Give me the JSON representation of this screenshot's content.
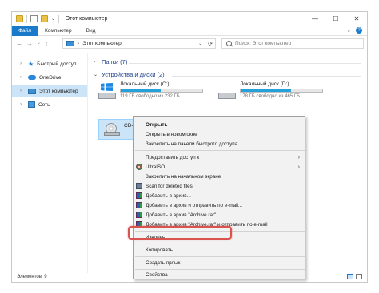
{
  "window": {
    "title": "Этот компьютер",
    "controls": {
      "minimize": "—",
      "maximize": "☐",
      "close": "✕"
    }
  },
  "ribbon": {
    "tabs": [
      {
        "label": "Файл",
        "active": true
      },
      {
        "label": "Компьютер"
      },
      {
        "label": "Вид"
      }
    ],
    "expand": "⌄",
    "help": "?"
  },
  "address": {
    "path": "Этот компьютер",
    "chevron": "›",
    "dropdown": "⌄",
    "refresh": "⟳",
    "nav": {
      "back": "←",
      "forward": "→",
      "recent": "⌄",
      "up": "↑"
    }
  },
  "search": {
    "placeholder": "Поиск: Этот компьютер"
  },
  "sidebar": {
    "items": [
      {
        "label": "Быстрый доступ",
        "icon": "star-icon"
      },
      {
        "label": "OneDrive",
        "icon": "cloud-icon"
      },
      {
        "label": "Этот компьютер",
        "icon": "computer-icon",
        "selected": true
      },
      {
        "label": "Сеть",
        "icon": "network-icon"
      }
    ]
  },
  "groups": {
    "folders": {
      "label": "Папки (7)",
      "collapsed": true
    },
    "devices": {
      "label": "Устройства и диски (2)",
      "collapsed": false
    }
  },
  "drives": [
    {
      "name": "Локальный диск (C:)",
      "free": "119 ГБ свободно из 232 ГБ",
      "used_fraction": 0.49
    },
    {
      "name": "Локальный диск (D:)",
      "free": "178 ГБ свободно из 465 ГБ",
      "used_fraction": 0.62
    },
    {
      "name": "CD-дисковод (F:)"
    }
  ],
  "status": {
    "items": "Элементов: 9"
  },
  "context_menu": {
    "items": [
      {
        "label": "Открыть",
        "bold": true
      },
      {
        "label": "Открыть в новом окне"
      },
      {
        "label": "Закрепить на панели быстрого доступа"
      },
      {
        "label": "Предоставить доступ к",
        "submenu": true
      },
      {
        "label": "UltraISO",
        "submenu": true,
        "icon": "ultraiso-icon"
      },
      {
        "label": "Закрепить на начальном экране"
      },
      {
        "label": "Scan for deleted files",
        "icon": "scan-icon"
      },
      {
        "label": "Добавить в архив...",
        "icon": "winrar-icon"
      },
      {
        "label": "Добавить в архив и отправить по e-mail...",
        "icon": "winrar-icon"
      },
      {
        "label": "Добавить в архив \"Archive.rar\"",
        "icon": "winrar-icon"
      },
      {
        "label": "Добавить в архив \"Archive.rar\" и отправить по e-mail",
        "icon": "winrar-icon"
      },
      {
        "label": "Извлечь",
        "highlighted": true
      },
      {
        "label": "Копировать"
      },
      {
        "label": "Создать ярлык"
      },
      {
        "label": "Свойства"
      }
    ],
    "submenu_arrow": "›"
  },
  "colors": {
    "accent": "#1979ca",
    "selection": "#cce4f7",
    "drive_bar": "#26a0da",
    "highlight": "#d9534f"
  }
}
